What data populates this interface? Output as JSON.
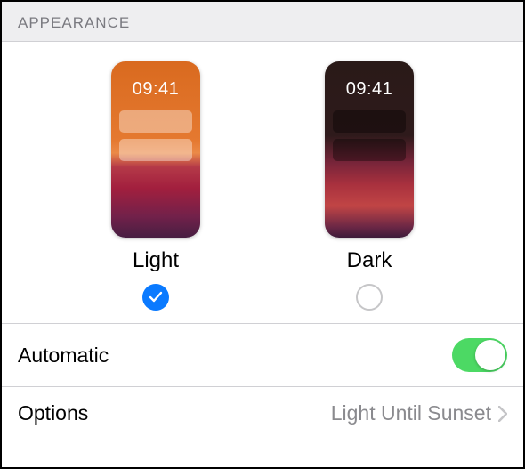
{
  "section": {
    "header": "APPEARANCE"
  },
  "appearance": {
    "light": {
      "label": "Light",
      "preview_time": "09:41",
      "selected": true
    },
    "dark": {
      "label": "Dark",
      "preview_time": "09:41",
      "selected": false
    }
  },
  "automatic": {
    "label": "Automatic",
    "enabled": true
  },
  "options": {
    "label": "Options",
    "value": "Light Until Sunset"
  }
}
